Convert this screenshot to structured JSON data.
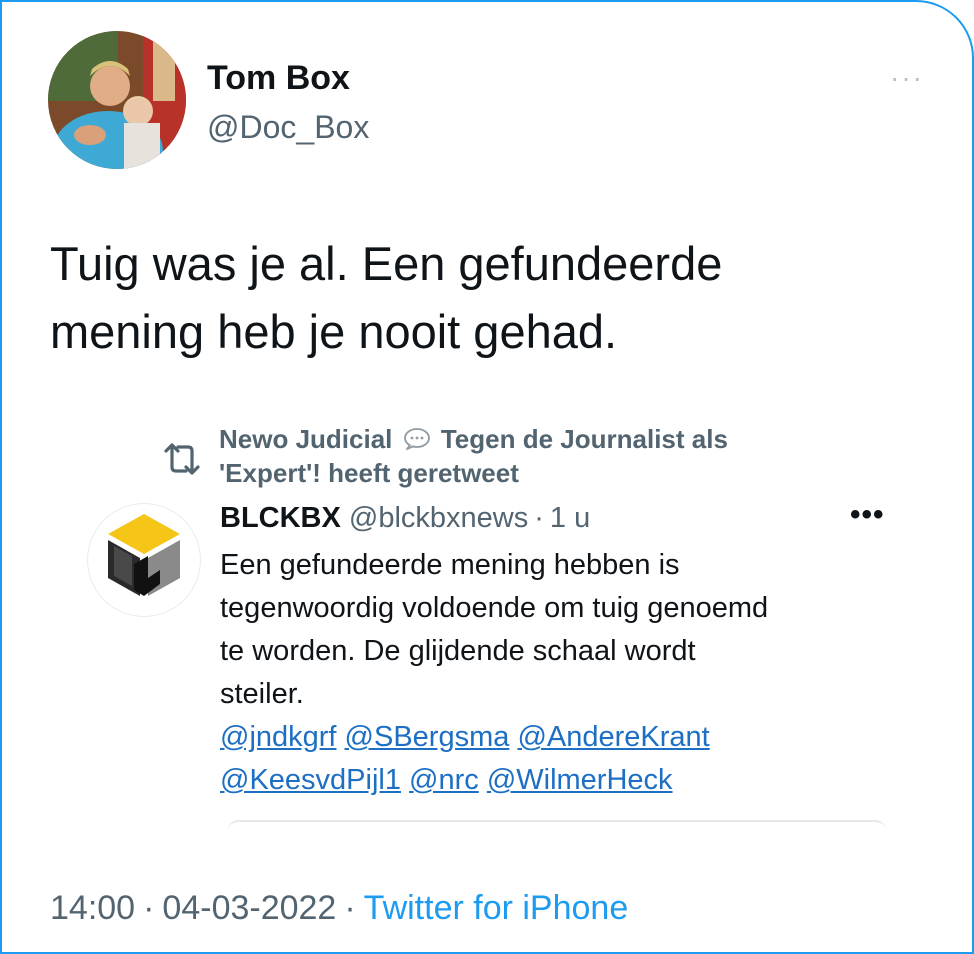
{
  "author": {
    "name": "Tom Box",
    "handle": "@Doc_Box"
  },
  "menu_more": "···",
  "tweet": {
    "line1": "Tuig was je al. Een gefundeerde",
    "line2": "mening heb je nooit gehad."
  },
  "retweet_context": {
    "part1": "Newo Judicial",
    "part2": "Tegen de Journalist als",
    "part3": "'Expert'! heeft geretweet",
    "icon": "retweet-icon"
  },
  "quoted": {
    "name": "BLCKBX",
    "handle": "@blckbxnews",
    "separator": "·",
    "time": "1 u",
    "more": "•••",
    "text_lines": [
      "Een gefundeerde mening hebben is",
      "tegenwoordig voldoende om tuig genoemd",
      "te worden. De glijdende schaal wordt",
      "steiler."
    ],
    "mentions": [
      "@jndkgrf",
      "@SBergsma",
      "@AndereKrant",
      "@KeesvdPijl1",
      "@nrc",
      "@WilmerHeck"
    ]
  },
  "footer": {
    "time": "14:00",
    "sep1": "·",
    "date": "04-03-2022",
    "sep2": "·",
    "source": "Twitter for iPhone"
  },
  "colors": {
    "accent": "#1d9bf0",
    "text": "#0f1419",
    "muted": "#536471",
    "mention": "#1d6fc4",
    "logo_yellow": "#f5c518"
  }
}
